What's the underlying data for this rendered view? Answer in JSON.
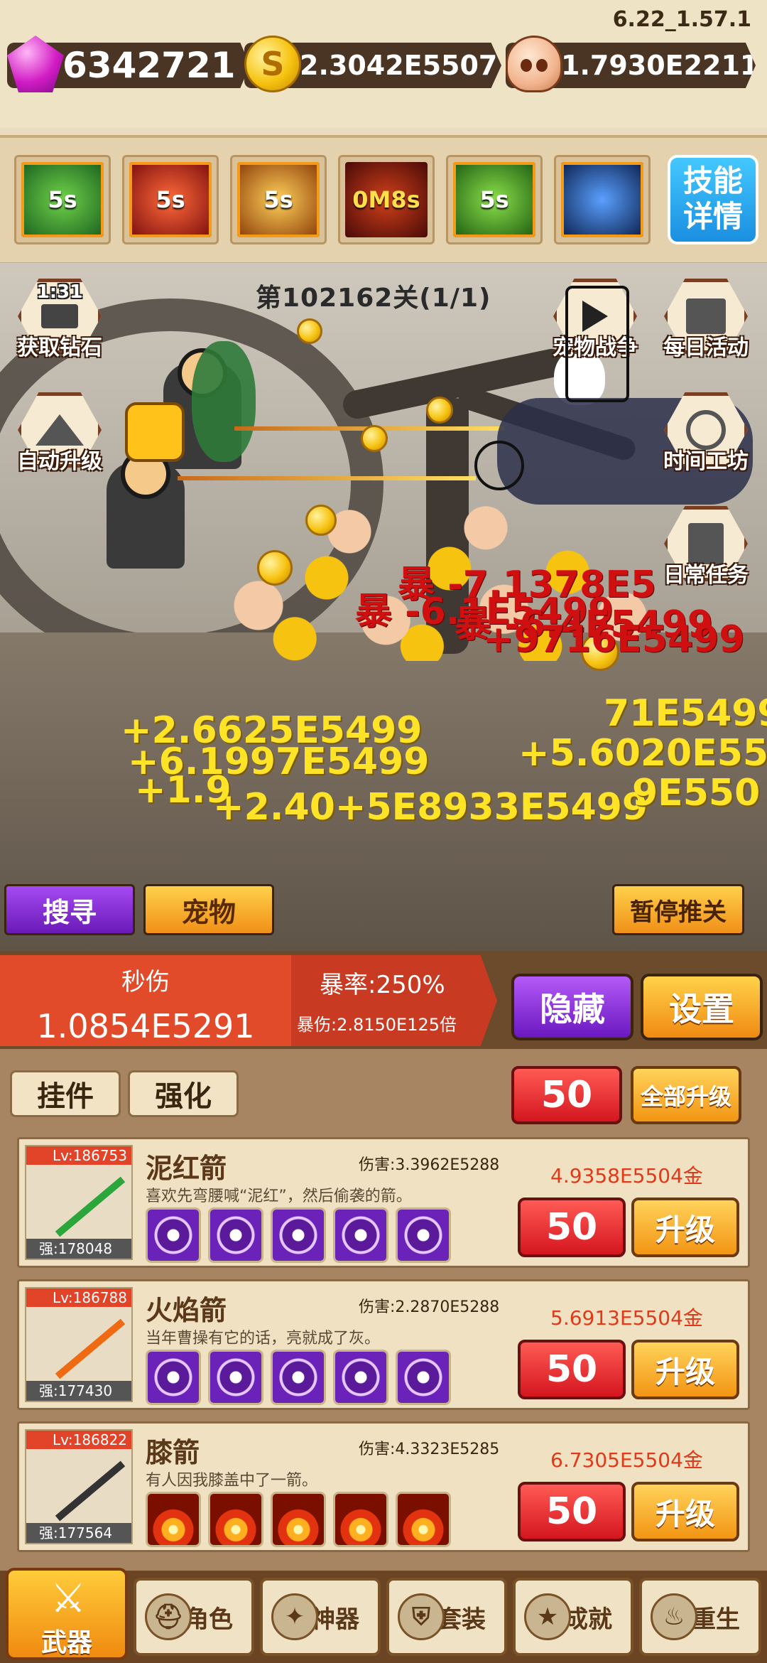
{
  "version": "6.22_1.57.1",
  "currencies": {
    "gems": "6342721",
    "gold": "2.3042E5507",
    "skulls": "1.7930E2211",
    "gold_symbol": "S"
  },
  "skills": [
    {
      "timer": "5s",
      "color": "#2e8f3a"
    },
    {
      "timer": "5s",
      "color": "#b2201a"
    },
    {
      "timer": "5s",
      "color": "#c46a12"
    },
    {
      "timer": "0M8s",
      "color": "#7a1612"
    },
    {
      "timer": "5s",
      "color": "#3a8a28"
    },
    {
      "timer": "",
      "color": "#16366e"
    }
  ],
  "skill_info_label": "技能详情",
  "level_text": "第102162关(1/1)",
  "side_buttons": {
    "get_diamonds": {
      "label": "获取钻石",
      "timer": "1:31"
    },
    "auto_upgrade": {
      "label": "自动升级"
    },
    "pet_battle": {
      "label": "宠物战争"
    },
    "daily_activity": {
      "label": "每日活动"
    },
    "time_workshop": {
      "label": "时间工坊"
    },
    "daily_tasks": {
      "label": "日常任务"
    }
  },
  "damage_floaters": {
    "red": [
      "暴 -7.1378E5",
      "暴 -6.1E5499",
      "暴 -6.4E5499",
      "+9716E5499"
    ],
    "yellow": [
      "+2.6625E5499",
      "+6.1997E5499",
      "+1.9",
      "+2.40+5E8933E5499",
      "+5.6020E55",
      "71E5499",
      "9E550"
    ]
  },
  "action_buttons": {
    "search": "搜寻",
    "pets": "宠物",
    "pause": "暂停推关"
  },
  "stats": {
    "dps_label": "秒伤",
    "dps_value": "1.0854E5291",
    "crit_rate": "暴率:250%",
    "crit_damage": "暴伤:2.8150E125倍",
    "hide_label": "隐藏",
    "settings_label": "设置"
  },
  "panel": {
    "tab_pendant": "挂件",
    "tab_enhance": "强化",
    "multiplier": "50",
    "upgrade_all": "全部升级"
  },
  "weapons": [
    {
      "level": "Lv:186753",
      "name": "泥红箭",
      "damage": "伤害:3.3962E5288",
      "desc": "喜欢先弯腰喊“泥红”，然后偷袭的箭。",
      "cost": "4.9358E5504金",
      "strength": "强:178048",
      "qty": "50",
      "upgrade": "升级",
      "rune": "yy",
      "rune_tags": [
        "混",
        "元"
      ]
    },
    {
      "level": "Lv:186788",
      "name": "火焰箭",
      "damage": "伤害:2.2870E5288",
      "desc": "当年曹操有它的话，亮就成了灰。",
      "cost": "5.6913E5504金",
      "strength": "强:177430",
      "qty": "50",
      "upgrade": "升级",
      "rune": "yy",
      "rune_tags": [
        "混",
        "元"
      ]
    },
    {
      "level": "Lv:186822",
      "name": "膝箭",
      "damage": "伤害:4.3323E5285",
      "desc": "有人因我膝盖中了一箭。",
      "cost": "6.7305E5504金",
      "strength": "强:177564",
      "qty": "50",
      "upgrade": "升级",
      "rune": "fire",
      "rune_tags": []
    }
  ],
  "nav": [
    {
      "label": "武器",
      "icon": "crossed-swords-icon"
    },
    {
      "label": "角色",
      "icon": "helmet-icon"
    },
    {
      "label": "神器",
      "icon": "winged-artifact-icon"
    },
    {
      "label": "套装",
      "icon": "armor-icon"
    },
    {
      "label": "成就",
      "icon": "trophy-icon"
    },
    {
      "label": "重生",
      "icon": "rebirth-flame-icon"
    }
  ]
}
